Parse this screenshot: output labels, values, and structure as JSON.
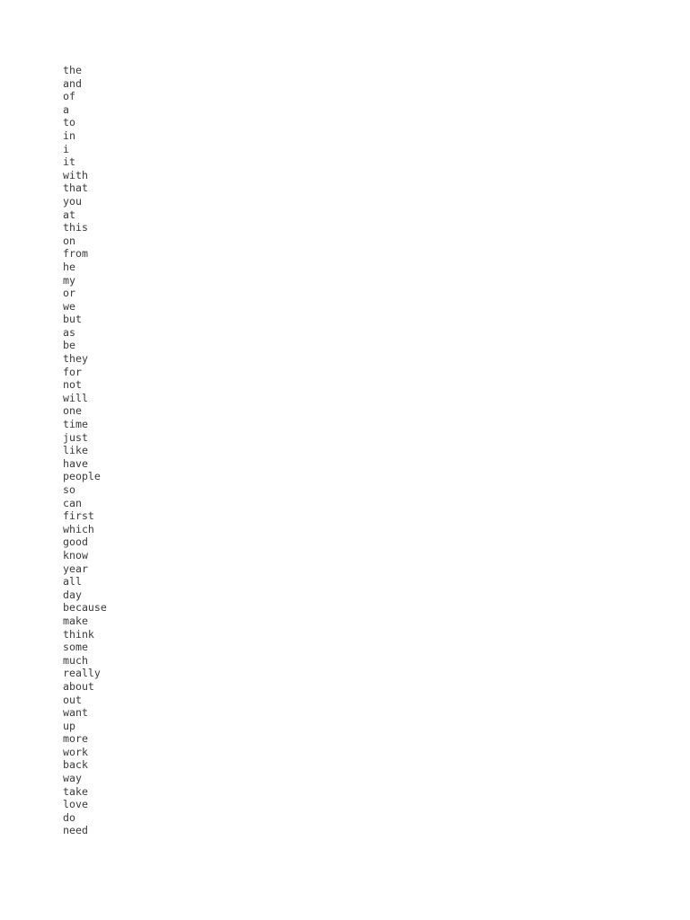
{
  "document": {
    "type": "plain-text-word-list",
    "background_color": "#ffffff",
    "text_color": "#3a3a3a",
    "word_count": 59,
    "words": [
      "the",
      "and",
      "of",
      "a",
      "to",
      "in",
      "i",
      "it",
      "with",
      "that",
      "you",
      "at",
      "this",
      "on",
      "from",
      "he",
      "my",
      "or",
      "we",
      "but",
      "as",
      "be",
      "they",
      "for",
      "not",
      "will",
      "one",
      "time",
      "just",
      "like",
      "have",
      "people",
      "so",
      "can",
      "first",
      "which",
      "good",
      "know",
      "year",
      "all",
      "day",
      "because",
      "make",
      "think",
      "some",
      "much",
      "really",
      "about",
      "out",
      "want",
      "up",
      "more",
      "work",
      "back",
      "way",
      "take",
      "love",
      "do",
      "need"
    ]
  }
}
